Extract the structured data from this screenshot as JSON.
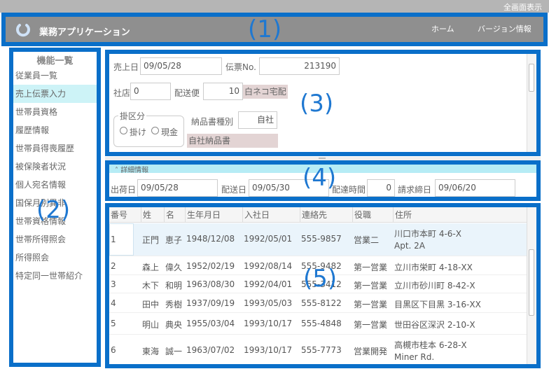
{
  "top": {
    "fullscreen_label": "全画面表示"
  },
  "header": {
    "app_title": "業務アプリケーション",
    "menu": {
      "home": "ホーム",
      "version": "バージョン情報"
    }
  },
  "region_labels": {
    "r1": "(1)",
    "r2": "(2)",
    "r3": "(3)",
    "r4": "(4)",
    "r5": "(5)"
  },
  "sidebar": {
    "title": "機能一覧",
    "items": [
      {
        "label": "従業員一覧"
      },
      {
        "label": "売上伝票入力"
      },
      {
        "label": "世帯員資格"
      },
      {
        "label": "履歴情報"
      },
      {
        "label": "世帯員得喪履歴"
      },
      {
        "label": "被保険者状況"
      },
      {
        "label": "個人宛名情報"
      },
      {
        "label": "国保月別異非"
      },
      {
        "label": "世帯資格情報"
      },
      {
        "label": "世帯所得照会"
      },
      {
        "label": "所得照会"
      },
      {
        "label": "特定同一世帯紹介"
      }
    ]
  },
  "form": {
    "sales_date_label": "売上日",
    "sales_date": "09/05/28",
    "slip_no_label": "伝票No.",
    "slip_no": "213190",
    "branch_label": "社店",
    "branch": "0",
    "delivery_label": "配送便",
    "delivery_code": "10",
    "delivery_name": "白ネコ宅配",
    "payment_group": "掛区分",
    "payment_credit": "掛け",
    "payment_cash": "現金",
    "doc_type_label": "納品書種別",
    "doc_type": "自社",
    "doc_type_name": "自社納品書"
  },
  "details": {
    "header": "詳細情報",
    "ship_date_label": "出荷日",
    "ship_date": "09/05/28",
    "delivery_date_label": "配送日",
    "delivery_date": "09/05/30",
    "delivery_time_label": "配達時間",
    "delivery_time": "0",
    "billing_close_label": "請求締日",
    "billing_close": "09/06/20"
  },
  "grid": {
    "columns": [
      "番号",
      "姓",
      "名",
      "生年月日",
      "入社日",
      "連絡先",
      "役職",
      "住所"
    ],
    "rows": [
      {
        "no": "1",
        "last": "正門",
        "first": "恵子",
        "birth": "1948/12/08",
        "hired": "1992/05/01",
        "phone": "555-9857",
        "title": "営業二",
        "addr1": "川口市本町 4-6-X",
        "addr2": "Apt. 2A"
      },
      {
        "no": "2",
        "last": "森上",
        "first": "偉久",
        "birth": "1952/02/19",
        "hired": "1992/08/14",
        "phone": "555-9482",
        "title": "第一営業",
        "addr1": "立川市栄町 4-18-XX",
        "addr2": ""
      },
      {
        "no": "3",
        "last": "木下",
        "first": "和明",
        "birth": "1963/08/30",
        "hired": "1992/04/01",
        "phone": "555-3412",
        "title": "第一営業",
        "addr1": "立川市砂川町 8-42-X",
        "addr2": ""
      },
      {
        "no": "4",
        "last": "田中",
        "first": "秀樹",
        "birth": "1937/09/19",
        "hired": "1993/05/03",
        "phone": "555-8122",
        "title": "第一営業",
        "addr1": "目黒区下目黒 3-16-XX",
        "addr2": ""
      },
      {
        "no": "5",
        "last": "明山",
        "first": "典央",
        "birth": "1955/03/04",
        "hired": "1993/10/17",
        "phone": "555-4848",
        "title": "第一営業",
        "addr1": "世田谷区深沢 2-10-X",
        "addr2": ""
      },
      {
        "no": "6",
        "last": "東海",
        "first": "誠一",
        "birth": "1963/07/02",
        "hired": "1993/10/17",
        "phone": "555-7773",
        "title": "営業開発",
        "addr1": "高槻市桂本 6-28-X",
        "addr2": "Miner Rd."
      }
    ]
  },
  "colors": {
    "annotation_border": "#0a6fc9",
    "header_bg": "#8f8f8f",
    "selected_nav": "#cdf3f7",
    "detail_bar": "#b6ecf5"
  }
}
